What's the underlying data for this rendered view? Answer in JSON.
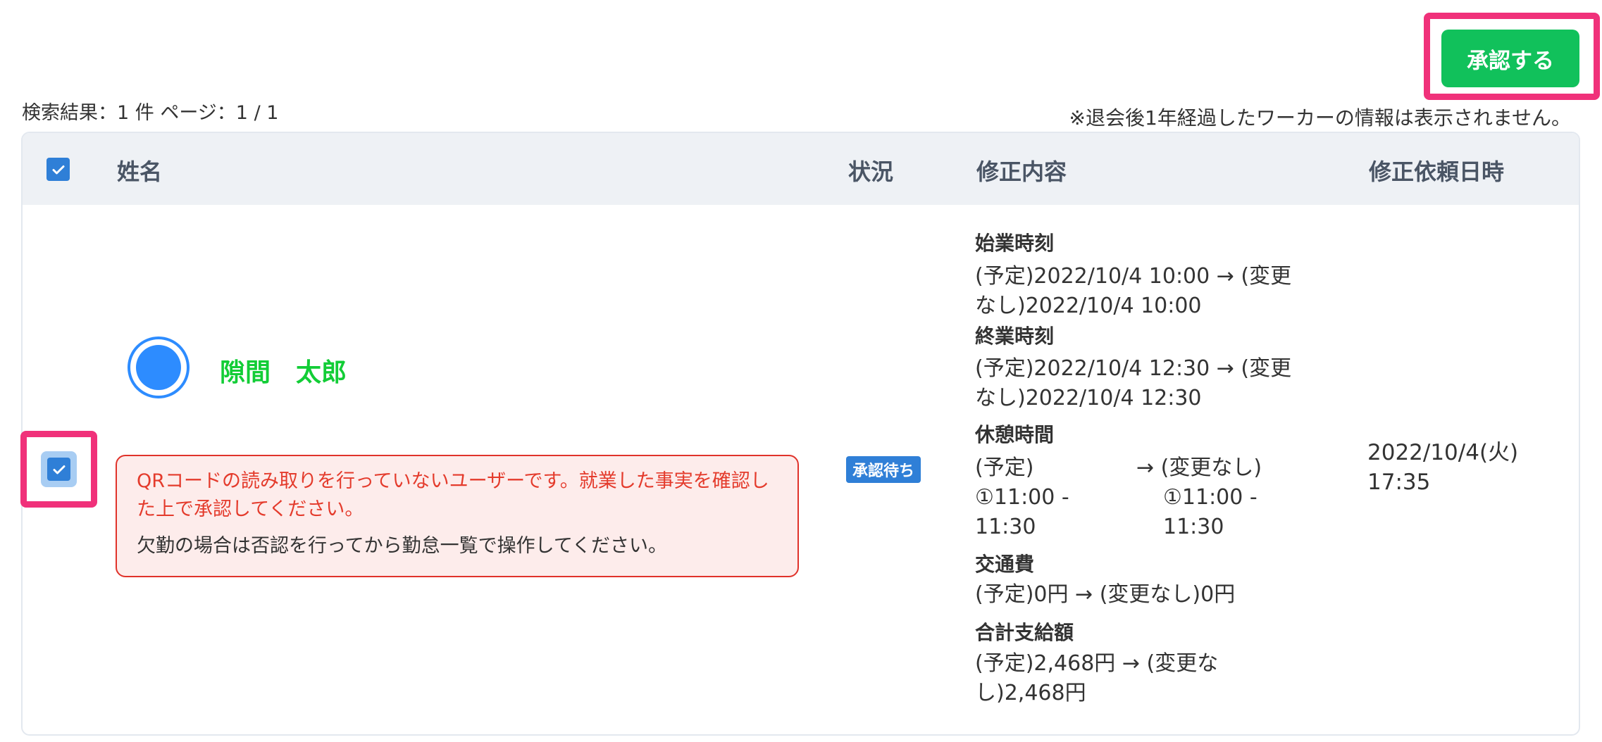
{
  "toolbar": {
    "approve_label": "承認する"
  },
  "search": {
    "summary": "検索結果：1 件 ページ：1 / 1"
  },
  "notice": {
    "retention": "※退会後1年経過したワーカーの情報は表示されません。"
  },
  "table": {
    "columns": {
      "name": "姓名",
      "status": "状況",
      "changes": "修正内容",
      "requested_at": "修正依頼日時"
    },
    "rows": [
      {
        "selected": true,
        "worker_name": "隙間　太郎",
        "warning_red": "QRコードの読み取りを行っていないユーザーです。就業した事実を確認した上で承認してください。",
        "warning_black": "欠勤の場合は否認を行ってから勤怠一覧で操作してください。",
        "status": "承認待ち",
        "changes": {
          "start_title": "始業時刻",
          "start_line1": "(予定)2022/10/4 10:00 → (変更",
          "start_line2": "なし)2022/10/4 10:00",
          "end_title": "終業時刻",
          "end_line1": "(予定)2022/10/4 12:30 → (変更",
          "end_line2": "なし)2022/10/4 12:30",
          "break_title": "休憩時間",
          "break_before_label": "(予定)",
          "break_before_line1": "①11:00 -",
          "break_before_line2": "11:30",
          "break_after_label": "→ (変更なし)",
          "break_after_line1": "①11:00 -",
          "break_after_line2": "11:30",
          "transport_title": "交通費",
          "transport_line": "(予定)0円 → (変更なし)0円",
          "total_title": "合計支給額",
          "total_line1": "(予定)2,468円 → (変更な",
          "total_line2": "し)2,468円"
        },
        "requested_at_date": "2022/10/4(火)",
        "requested_at_time": "17:35"
      }
    ]
  },
  "colors": {
    "accent": "#2f7fd7",
    "approve": "#11c15b",
    "highlight": "#f0317a",
    "name": "#12cd36",
    "warning": "#e43b2c"
  }
}
